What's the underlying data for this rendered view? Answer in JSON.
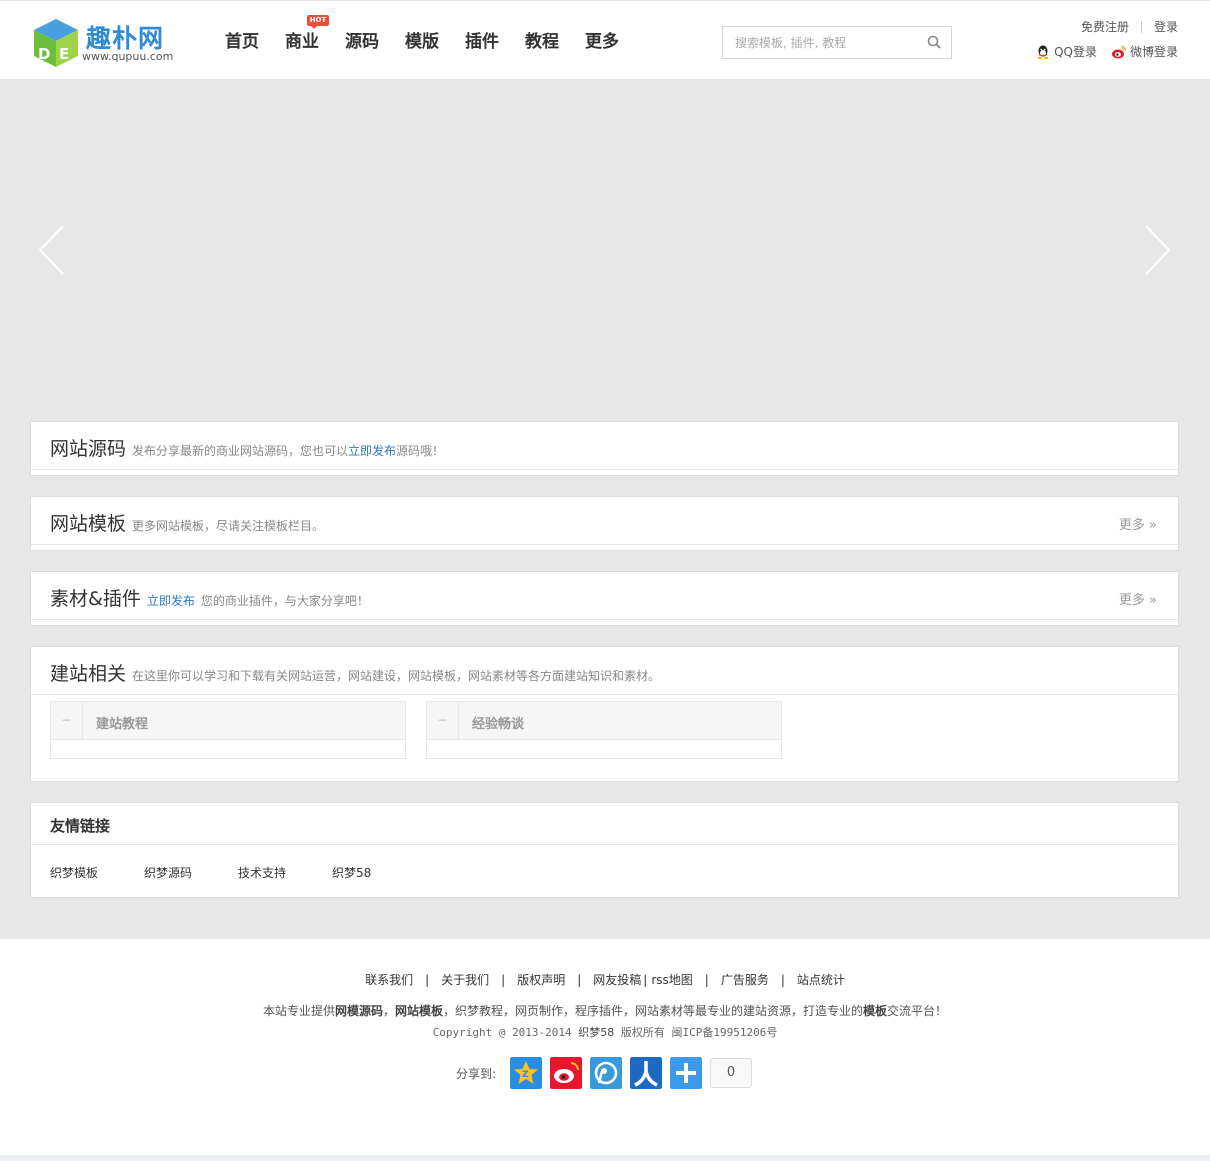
{
  "logo": {
    "name": "趣朴网",
    "url": "www.qupuu.com",
    "cube_letters": "DE"
  },
  "nav": {
    "items": [
      {
        "label": "首页"
      },
      {
        "label": "商业"
      },
      {
        "label": "源码"
      },
      {
        "label": "模版"
      },
      {
        "label": "插件"
      },
      {
        "label": "教程"
      },
      {
        "label": "更多"
      }
    ],
    "hot_badge": "HOT"
  },
  "search": {
    "placeholder": "搜索模板, 插件, 教程"
  },
  "account": {
    "register": "免费注册",
    "login": "登录",
    "qq_login": "QQ登录",
    "weibo_login": "微博登录"
  },
  "sections": {
    "source": {
      "title": "网站源码",
      "desc_before": "发布分享最新的商业网站源码，您也可以",
      "desc_link": "立即发布",
      "desc_after": "源码哦！"
    },
    "template": {
      "title": "网站模板",
      "desc": "更多网站模板，尽请关注模板栏目。",
      "more": "更多"
    },
    "plugin": {
      "title": "素材&插件",
      "desc_link": "立即发布",
      "desc_after": "您的商业插件，与大家分享吧！",
      "more": "更多"
    },
    "build": {
      "title": "建站相关",
      "desc": "在这里你可以学习和下载有关网站运营，网站建设，网站模板，网站素材等各方面建站知识和素材。",
      "panels": [
        {
          "icon": "−",
          "title": "建站教程"
        },
        {
          "icon": "−",
          "title": "经验畅谈"
        }
      ]
    },
    "links": {
      "title": "友情链接",
      "items": [
        "织梦模板",
        "织梦源码",
        "技术支持",
        "织梦58"
      ]
    }
  },
  "footer": {
    "links": [
      "联系我们",
      "关于我们",
      "版权声明",
      "网友投稿",
      "rss地图",
      "广告服务",
      "站点统计"
    ],
    "desc_1": "本站专业提供",
    "desc_b1": "网模源码",
    "desc_2": "，",
    "desc_b2": "网站模板",
    "desc_3": "，织梦教程，网页制作，程序插件，网站素材等最专业的建站资源，打造专业的",
    "desc_b3": "模板",
    "desc_4": "交流平台！",
    "copy_1": "Copyright  @  2013-2014 ",
    "copy_site": "织梦58",
    "copy_2": " 版权所有  闽ICP备19951206号",
    "share_label": "分享到:",
    "share_count": "0"
  },
  "colors": {
    "accent": "#2b78c4",
    "logo_blue": "#2e8bd8",
    "hot": "#ee4b3a",
    "background": "#e7e7e7"
  }
}
